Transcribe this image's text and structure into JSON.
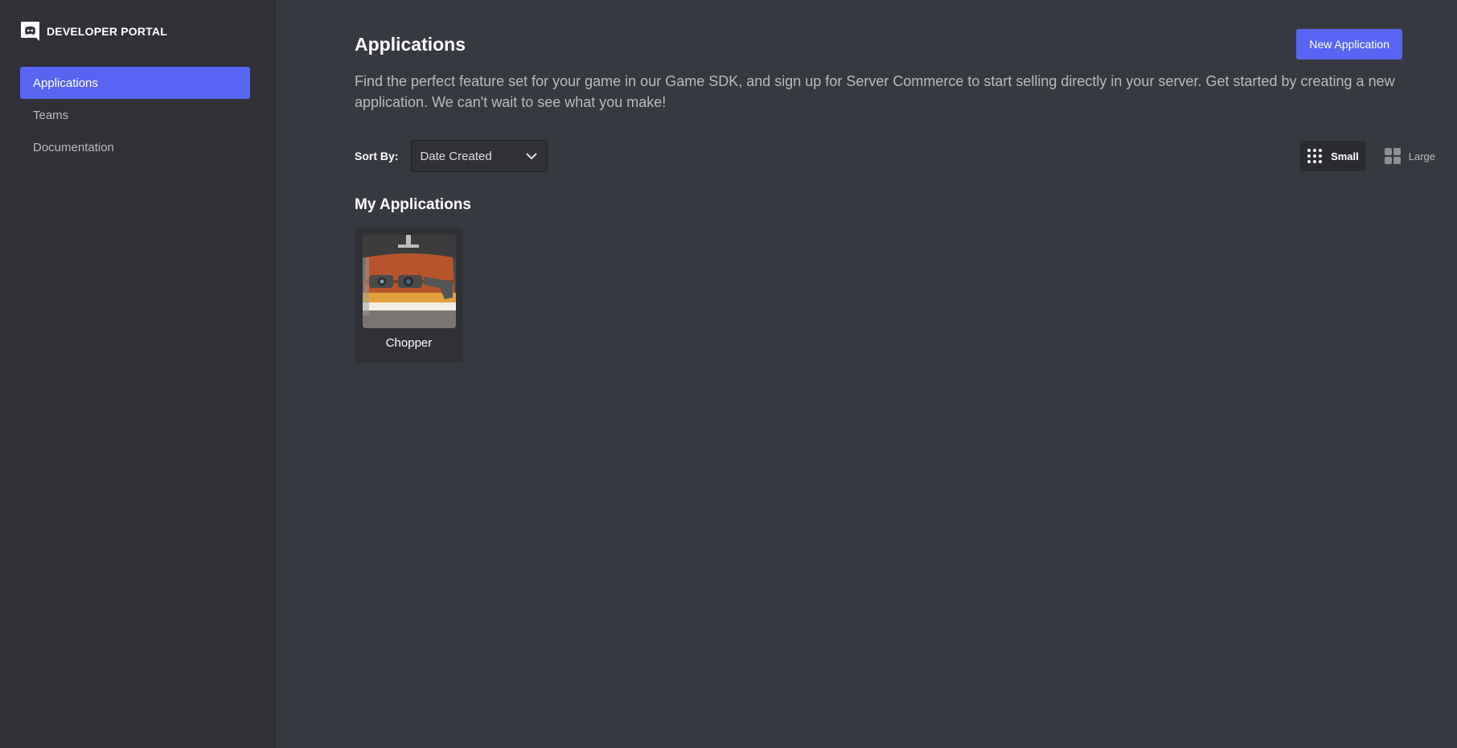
{
  "sidebar": {
    "brand": "DEVELOPER PORTAL",
    "items": [
      {
        "label": "Applications",
        "active": true
      },
      {
        "label": "Teams",
        "active": false
      },
      {
        "label": "Documentation",
        "active": false
      }
    ]
  },
  "main": {
    "title": "Applications",
    "new_app_label": "New Application",
    "description": "Find the perfect feature set for your game in our Game SDK, and sign up for Server Commerce to start selling directly in your server. Get started by creating a new application. We can't wait to see what you make!",
    "sort": {
      "label": "Sort By:",
      "selected": "Date Created"
    },
    "view": {
      "small_label": "Small",
      "large_label": "Large",
      "selected": "Small"
    },
    "section_title": "My Applications",
    "apps": [
      {
        "name": "Chopper"
      }
    ]
  },
  "colors": {
    "accent": "#5865f2",
    "sidebar_bg": "#2f3136",
    "main_bg": "#36393f"
  }
}
